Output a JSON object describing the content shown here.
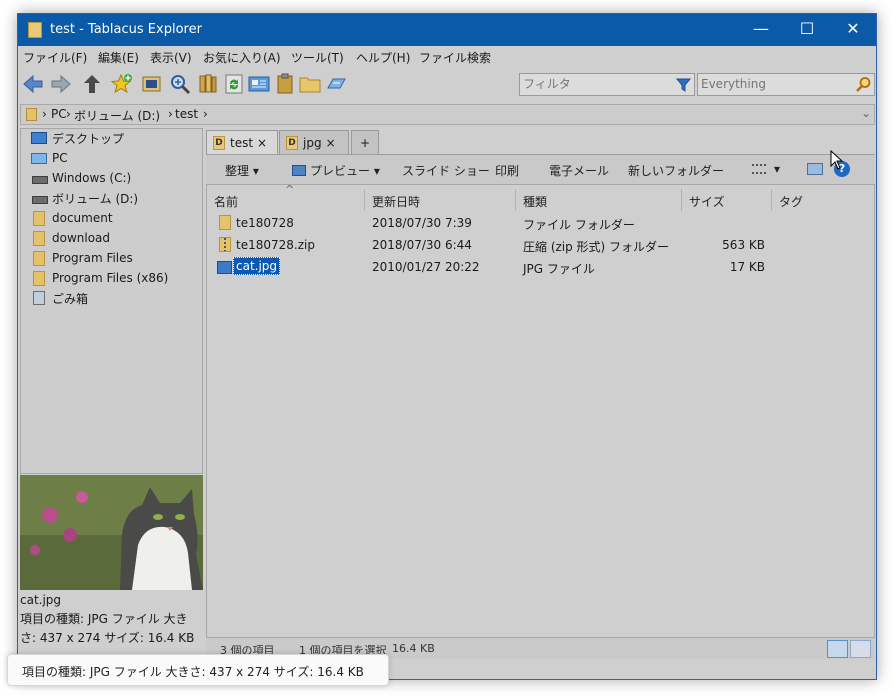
{
  "window": {
    "title": "test - Tablacus Explorer",
    "controls": {
      "minimize": "—",
      "maximize": "☐",
      "close": "✕"
    }
  },
  "menu": [
    "ファイル(F)",
    "編集(E)",
    "表示(V)",
    "お気に入り(A)",
    "ツール(T)",
    "ヘルプ(H)",
    "ファイル検索"
  ],
  "toolbar": {
    "filter_placeholder": "フィルタ",
    "search_placeholder": "Everything",
    "buttons": [
      "back-icon",
      "forward-icon",
      "up-icon",
      "add-favorite-icon",
      "window-icon",
      "magnifier-icon",
      "library-icon",
      "refresh-icon",
      "panel-icon",
      "clipboard-icon",
      "new-folder-icon",
      "options-icon"
    ]
  },
  "address": {
    "sep": "›",
    "crumbs": [
      "PC",
      "ボリューム (D:)",
      "test"
    ],
    "trailing_sep": "›",
    "chevron": "⌄"
  },
  "nav": {
    "items": [
      {
        "label": "デスクトップ",
        "icon": "desktop-icon"
      },
      {
        "label": "PC",
        "icon": "pc-icon"
      },
      {
        "label": "Windows (C:)",
        "icon": "drive-icon"
      },
      {
        "label": "ボリューム (D:)",
        "icon": "drive-icon"
      },
      {
        "label": "document",
        "icon": "folder-icon"
      },
      {
        "label": "download",
        "icon": "folder-icon"
      },
      {
        "label": "Program Files",
        "icon": "folder-icon"
      },
      {
        "label": "Program Files (x86)",
        "icon": "folder-icon"
      },
      {
        "label": "ごみ箱",
        "icon": "recycle-bin-icon"
      }
    ]
  },
  "preview": {
    "filename": "cat.jpg",
    "details": "項目の種類: JPG ファイル 大きさ: 437 x 274 サイズ: 16.4 KB"
  },
  "tabs": [
    {
      "label": "test",
      "close": "×",
      "badge": "D"
    },
    {
      "label": "jpg",
      "close": "×",
      "badge": "D"
    }
  ],
  "tab_add": "+",
  "commands": {
    "organize": "整理 ▾",
    "preview": "プレビュー ▾",
    "slideshow": "スライド ショー",
    "print": "印刷",
    "email": "電子メール",
    "new_folder": "新しいフォルダー",
    "view_caret": "▾",
    "help": "?"
  },
  "columns": {
    "name": "名前",
    "modified": "更新日時",
    "type": "種類",
    "size": "サイズ",
    "tags": "タグ",
    "sort_caret": "^"
  },
  "files": [
    {
      "name": "te180728",
      "modified": "2018/07/30 7:39",
      "type": "ファイル フォルダー",
      "size": "",
      "icon": "folder-icon"
    },
    {
      "name": "te180728.zip",
      "modified": "2018/07/30 6:44",
      "type": "圧縮 (zip 形式) フォルダー",
      "size": "563 KB",
      "icon": "zip-icon"
    },
    {
      "name": "cat.jpg",
      "modified": "2010/01/27 20:22",
      "type": "JPG ファイル",
      "size": "17 KB",
      "icon": "image-icon",
      "selected": true
    }
  ],
  "status": {
    "count": "3 個の項目",
    "selection": "1 個の項目を選択",
    "selection_size": "16.4 KB"
  },
  "tooltip": "項目の種類: JPG ファイル 大きさ: 437 x 274 サイズ: 16.4 KB",
  "colors": {
    "titlebar": "#0a5aa8",
    "selection": "#0b58b0",
    "folder": "#e6c26a"
  }
}
